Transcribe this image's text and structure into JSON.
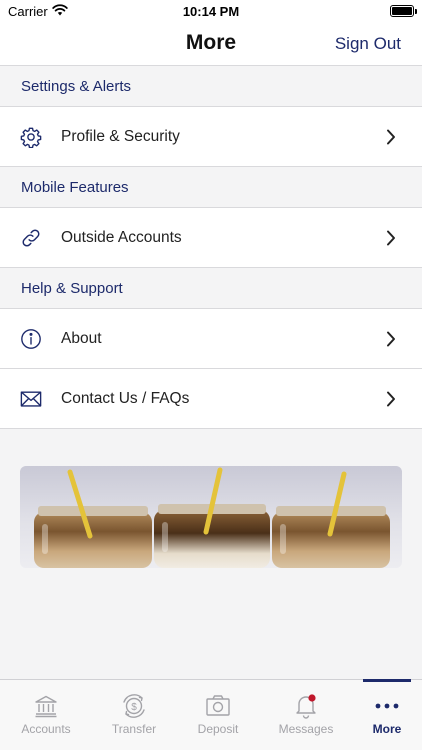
{
  "status_bar": {
    "carrier": "Carrier",
    "time": "10:14 PM"
  },
  "header": {
    "title": "More",
    "sign_out": "Sign Out"
  },
  "sections": [
    {
      "title": "Settings & Alerts",
      "items": [
        {
          "label": "Profile & Security",
          "icon": "gear-icon"
        }
      ]
    },
    {
      "title": "Mobile Features",
      "items": [
        {
          "label": "Outside Accounts",
          "icon": "link-icon"
        }
      ]
    },
    {
      "title": "Help & Support",
      "items": [
        {
          "label": "About",
          "icon": "info-icon"
        },
        {
          "label": "Contact Us / FAQs",
          "icon": "envelope-icon"
        }
      ]
    }
  ],
  "tabs": [
    {
      "label": "Accounts",
      "icon": "bank-icon",
      "active": false
    },
    {
      "label": "Transfer",
      "icon": "transfer-icon",
      "active": false
    },
    {
      "label": "Deposit",
      "icon": "camera-icon",
      "active": false
    },
    {
      "label": "Messages",
      "icon": "bell-icon",
      "active": false,
      "badge": true
    },
    {
      "label": "More",
      "icon": "more-icon",
      "active": true
    }
  ],
  "colors": {
    "accent": "#1d2a6b",
    "badge": "#c0172b",
    "inactive": "#a3a3a8"
  }
}
